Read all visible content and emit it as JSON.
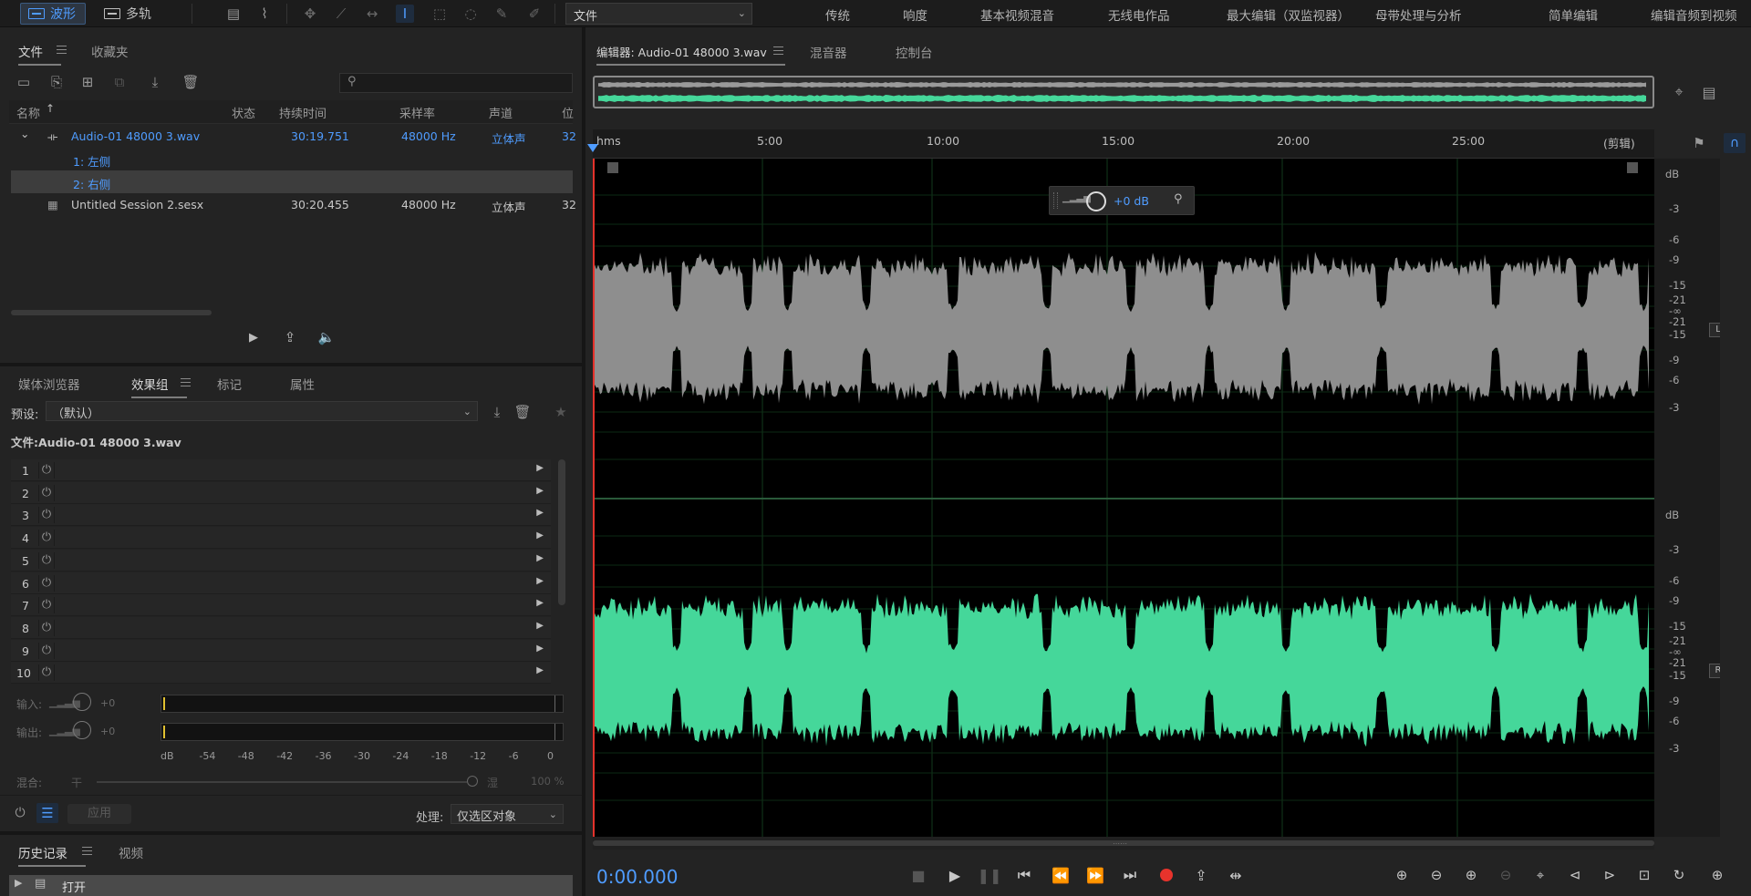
{
  "toolbar": {
    "waveform_label": "波形",
    "multitrack_label": "多轨",
    "workspace_select": "文件",
    "workspaces": [
      "传统",
      "响度",
      "基本视频混音",
      "无线电作品",
      "最大编辑（双监视器）",
      "母带处理与分析",
      "简单编辑",
      "编辑音频到视频"
    ]
  },
  "files_panel": {
    "tabs": [
      "文件",
      "收藏夹"
    ],
    "search_placeholder": "",
    "columns": [
      "名称",
      "状态",
      "持续时间",
      "采样率",
      "声道",
      "位"
    ],
    "rows": [
      {
        "name": "Audio-01 48000 3.wav",
        "duration": "30:19.751",
        "rate": "48000 Hz",
        "channels": "立体声",
        "bits": "32"
      },
      {
        "name": "1: 左侧"
      },
      {
        "name": "2: 右侧"
      },
      {
        "name": "Untitled Session 2.sesx",
        "duration": "30:20.455",
        "rate": "48000 Hz",
        "channels": "立体声",
        "bits": "32"
      }
    ]
  },
  "effects_panel": {
    "tabs": [
      "媒体浏览器",
      "效果组",
      "标记",
      "属性"
    ],
    "preset_label": "预设:",
    "preset_value": "（默认）",
    "file_label": "文件:Audio-01 48000 3.wav",
    "slots": [
      "1",
      "2",
      "3",
      "4",
      "5",
      "6",
      "7",
      "8",
      "9",
      "10"
    ],
    "input_label": "输入:",
    "input_value": "+0",
    "output_label": "输出:",
    "output_value": "+0",
    "scale": [
      "dB",
      "-54",
      "-48",
      "-42",
      "-36",
      "-30",
      "-24",
      "-18",
      "-12",
      "-6",
      "0"
    ],
    "mix_label": "混合:",
    "dry_label": "干",
    "wet_label": "湿",
    "mix_value": "100 %",
    "apply_label": "应用",
    "process_label": "处理:",
    "process_value": "仅选区对象"
  },
  "history_panel": {
    "tabs": [
      "历史记录",
      "视频"
    ],
    "first_item": "打开"
  },
  "editor": {
    "tabs": [
      "编辑器: Audio-01 48000 3.wav",
      "混音器",
      "控制台"
    ],
    "ruler_unit": "hms",
    "ruler_ticks": [
      "5:00",
      "10:00",
      "15:00",
      "20:00",
      "25:00"
    ],
    "ruler_end": "(剪辑)",
    "hud_gain": "+0 dB",
    "db_scale_top": [
      "dB",
      "-3",
      "-6",
      "-9",
      "-15",
      "-21",
      "-∞",
      "-21",
      "-15",
      "-9",
      "-6",
      "-3"
    ],
    "db_scale_bottom": [
      "dB",
      "-3",
      "-6",
      "-9",
      "-15",
      "-21",
      "-∞",
      "-21",
      "-15",
      "-9",
      "-6",
      "-3"
    ],
    "channel_left": "L",
    "channel_right": "R",
    "time": "0:00.000",
    "colors": {
      "left_wave": "#8e8e8e",
      "right_wave": "#45d79a",
      "accent": "#4f9cff",
      "record": "#e8332c"
    }
  }
}
